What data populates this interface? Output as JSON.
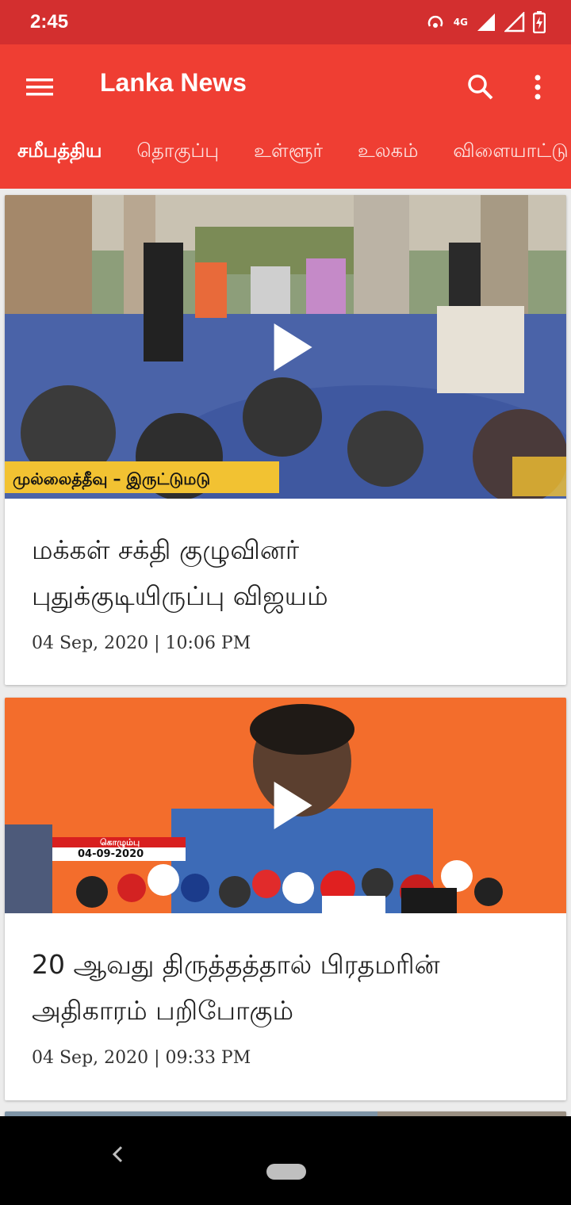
{
  "status": {
    "time": "2:45",
    "network": "4G"
  },
  "app": {
    "title": "Lanka News"
  },
  "tabs": [
    "சமீபத்திய",
    "தொகுப்பு",
    "உள்ளூர்",
    "உலகம்",
    "விளையாட்டு"
  ],
  "articles": [
    {
      "title": "மக்கள் சக்தி குழுவினர் புதுக்குடியிருப்பு விஜயம்",
      "date": "04 Sep, 2020 | 10:06 PM",
      "caption": "முல்லைத்தீவு – இருட்டுமடு"
    },
    {
      "title": "20 ஆவது திருத்தத்தால் பிரதமரின் அதிகாரம் பறிபோகும்",
      "date": "04 Sep, 2020 | 09:33 PM",
      "caption_city": "கொழும்பு",
      "caption_date": "04-09-2020"
    }
  ],
  "colors": {
    "appbar": "#ef3e33",
    "statusbar": "#d32f2f"
  }
}
